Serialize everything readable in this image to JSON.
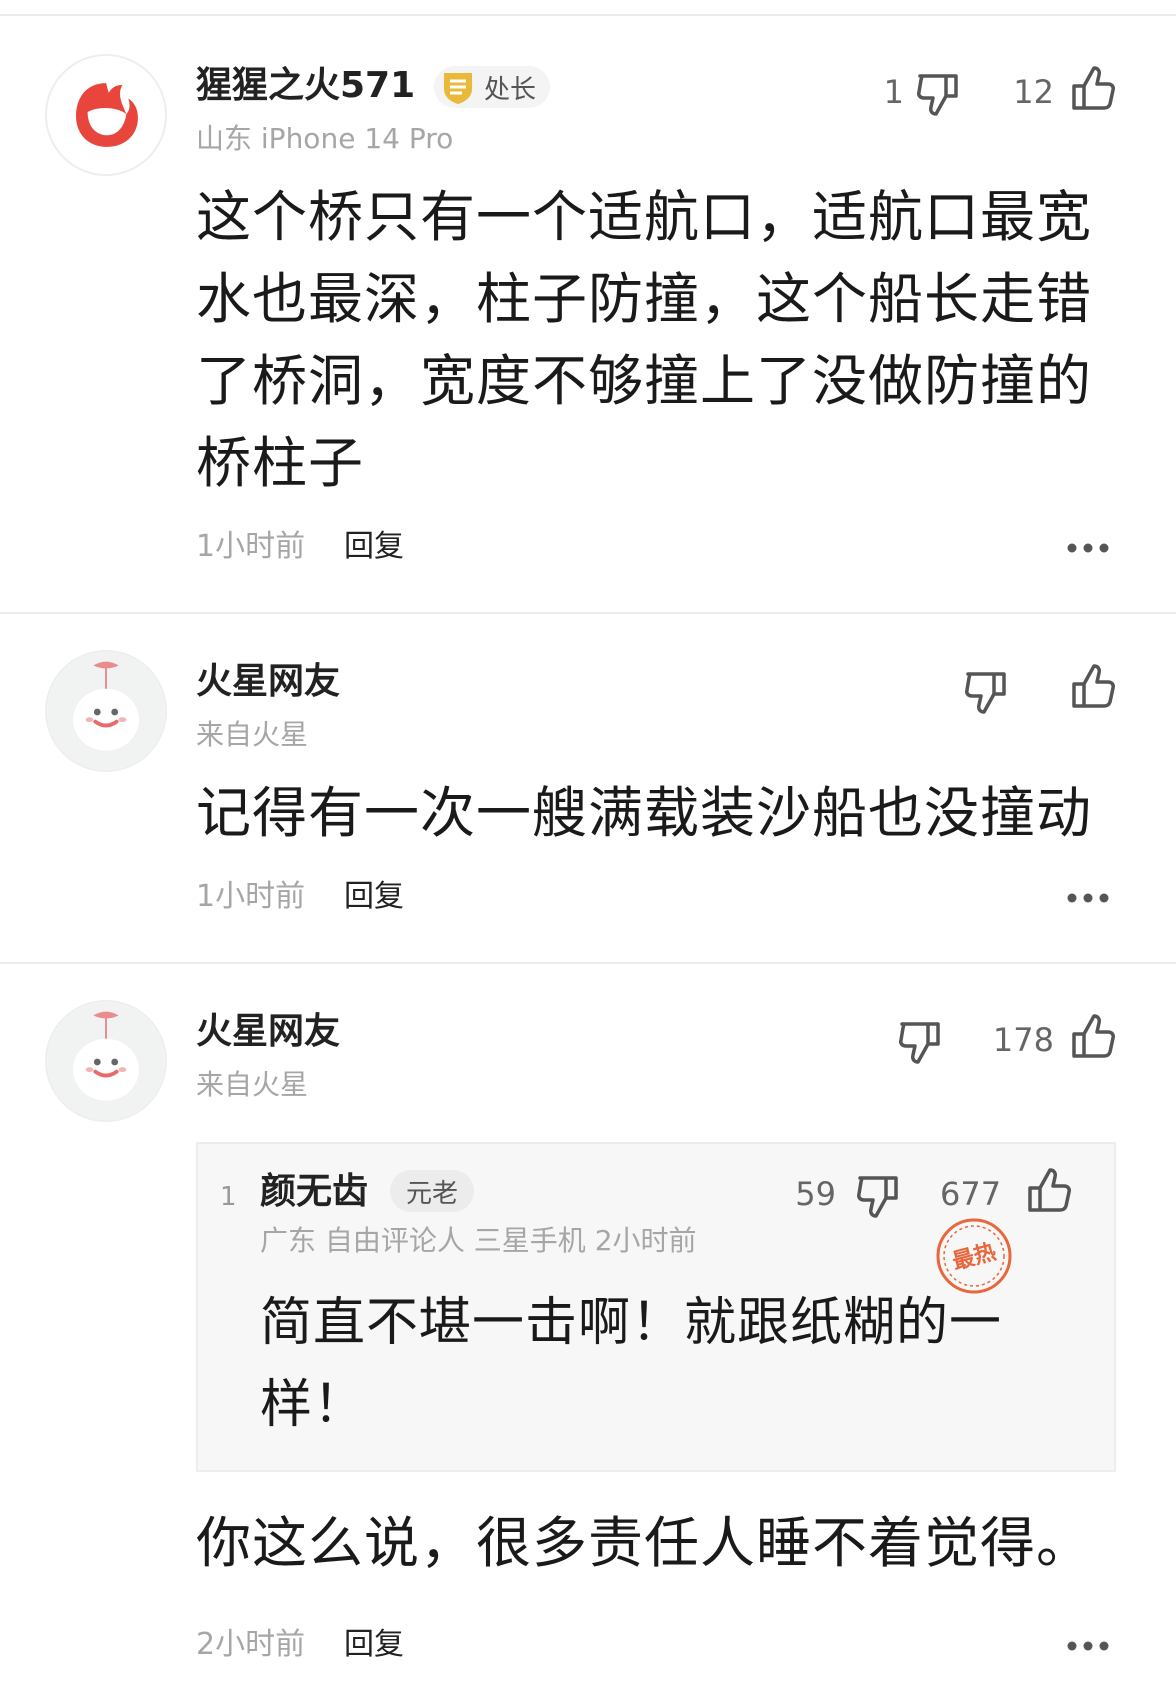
{
  "comments": [
    {
      "username": "猩猩之火571",
      "badge": "处长",
      "meta": "山东  iPhone 14 Pro",
      "dislike_count": "1",
      "like_count": "12",
      "text": "这个桥只有一个适航口，适航口最宽水也最深，柱子防撞，这个船长走错了桥洞，宽度不够撞上了没做防撞的桥柱子",
      "time": "1小时前",
      "reply_label": "回复"
    },
    {
      "username": "火星网友",
      "meta": "来自火星",
      "dislike_count": "",
      "like_count": "",
      "text": "记得有一次一艘满载装沙船也没撞动",
      "time": "1小时前",
      "reply_label": "回复"
    },
    {
      "username": "火星网友",
      "meta": "来自火星",
      "dislike_count": "",
      "like_count": "178",
      "quoted": {
        "rank": "1",
        "username": "颜无齿",
        "badge": "元老",
        "meta": "广东  自由评论人  三星手机  2小时前",
        "dislike_count": "59",
        "like_count": "677",
        "stamp": "最热",
        "text": "简直不堪一击啊！就跟纸糊的一样！"
      },
      "text": "你这么说，很多责任人睡不着觉得。",
      "time": "2小时前",
      "reply_label": "回复"
    }
  ],
  "icons": {
    "like": "thumbs-up-icon",
    "dislike": "thumbs-down-icon",
    "more": "more-dots-icon",
    "badge": "shield-badge-icon",
    "hot": "hot-stamp-icon"
  },
  "colors": {
    "accent_red": "#e8453c",
    "hot_orange": "#e8673c",
    "badge_gold": "#e9b93a",
    "meta_gray": "#a6a6a6"
  }
}
